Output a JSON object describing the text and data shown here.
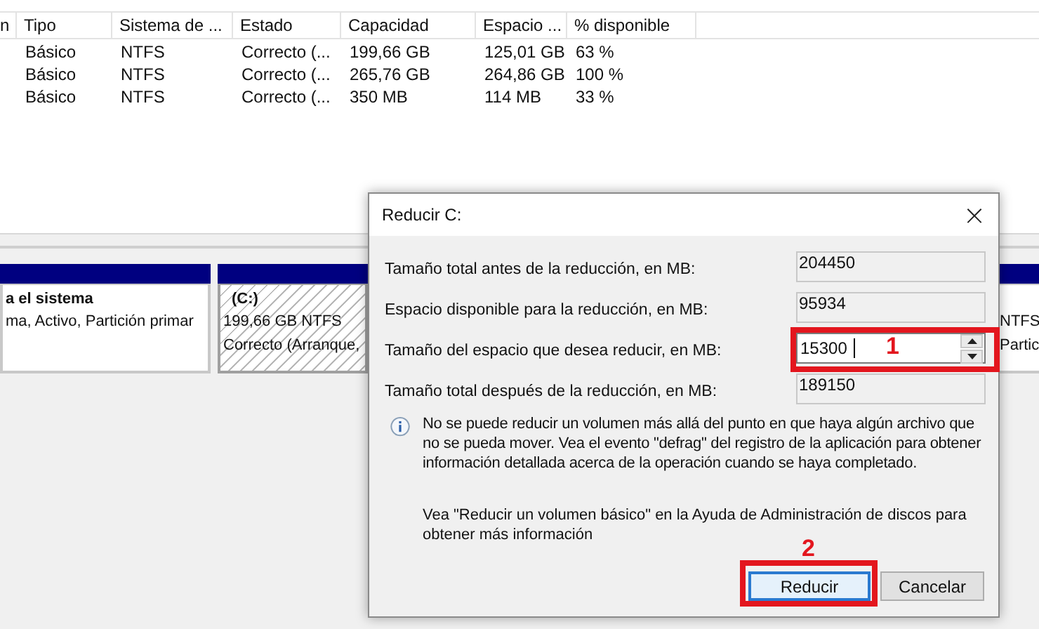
{
  "volume_table": {
    "columns": [
      "n",
      "Tipo",
      "Sistema de ...",
      "Estado",
      "Capacidad",
      "Espacio ...",
      "% disponible"
    ],
    "rows": [
      [
        "",
        "Básico",
        "NTFS",
        "Correcto (...",
        "199,66 GB",
        "125,01 GB",
        "63 %"
      ],
      [
        "",
        "Básico",
        "NTFS",
        "Correcto (...",
        "265,76 GB",
        "264,86 GB",
        "100 %"
      ],
      [
        "",
        "Básico",
        "NTFS",
        "Correcto (...",
        "350 MB",
        "114 MB",
        "33 %"
      ]
    ]
  },
  "disk_map": {
    "partitions": [
      {
        "name": "a el sistema",
        "lines": [
          "ma, Activo, Partición primar"
        ],
        "selected": false
      },
      {
        "name": "(C:)",
        "lines": [
          "199,66 GB NTFS",
          "Correcto (Arranque,"
        ],
        "selected": true
      },
      {
        "lines": [
          "NTFS",
          "Partic"
        ],
        "selected": false
      }
    ]
  },
  "dialog": {
    "title": "Reducir C:",
    "close": "×",
    "fields": [
      {
        "label": "Tamaño total antes de la reducción, en MB:",
        "value": "204450",
        "kind": "readonly"
      },
      {
        "label": "Espacio disponible para la reducción, en MB:",
        "value": "95934",
        "kind": "readonly"
      },
      {
        "label": "Tamaño del espacio que desea reducir, en MB:",
        "value": "15300",
        "kind": "spin",
        "annotation": "1"
      },
      {
        "label": "Tamaño total después de la reducción, en MB:",
        "value": "189150",
        "kind": "readonly"
      }
    ],
    "info": "No se puede reducir un volumen más allá del punto en que haya algún archivo que no se pueda mover. Vea el evento \"defrag\" del registro de la aplicación para obtener información detallada acerca de la operación cuando se haya completado.",
    "help": "Vea \"Reducir un volumen básico\"  en la Ayuda de Administración de discos para obtener más información",
    "buttons": [
      {
        "label": "Reducir",
        "default": true,
        "annotation": "2"
      },
      {
        "label": "Cancelar",
        "default": false
      }
    ]
  }
}
